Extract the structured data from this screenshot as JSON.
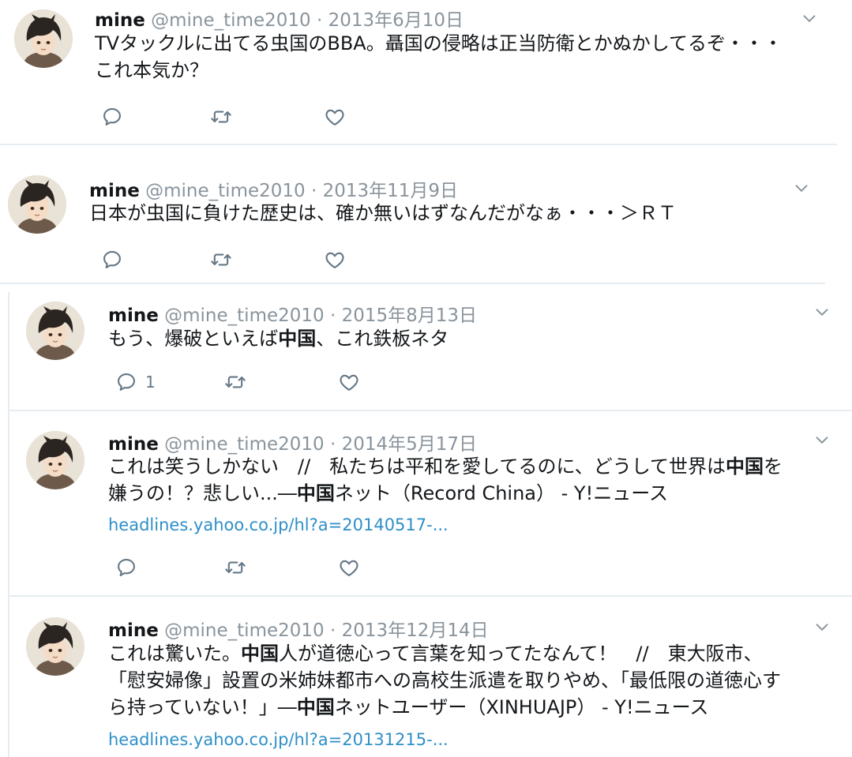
{
  "tweets": [
    {
      "name": "mine",
      "handle": "@mine_time2010",
      "sep": "·",
      "date": "2013年6月10日",
      "lines": [
        [
          {
            "t": "TVタックルに出てる虫国のBBA。聶国の侵略は正当防衛とかぬかしてるぞ・・・"
          }
        ],
        [
          {
            "t": "これ本気か？"
          }
        ]
      ],
      "reply_count": ""
    },
    {
      "name": "mine",
      "handle": "@mine_time2010",
      "sep": "·",
      "date": "2013年11月9日",
      "lines": [
        [
          {
            "t": "日本が虫国に負けた歴史は、確か無いはずなんだがなぁ・・・＞ＲＴ"
          }
        ]
      ],
      "reply_count": ""
    },
    {
      "name": "mine",
      "handle": "@mine_time2010",
      "sep": "·",
      "date": "2015年8月13日",
      "lines": [
        [
          {
            "t": "もう、爆破といえば"
          },
          {
            "t": "中国",
            "b": true
          },
          {
            "t": "、これ鉄板ネタ"
          }
        ]
      ],
      "reply_count": "1"
    },
    {
      "name": "mine",
      "handle": "@mine_time2010",
      "sep": "·",
      "date": "2014年5月17日",
      "lines": [
        [
          {
            "t": "これは笑うしかない　//　私たちは平和を愛してるのに、どうして世界は"
          },
          {
            "t": "中国",
            "b": true
          },
          {
            "t": "を"
          }
        ],
        [
          {
            "t": "嫌うの！？悲しい...―"
          },
          {
            "t": "中国",
            "b": true
          },
          {
            "t": "ネット（Record China） - Y!ニュース"
          }
        ]
      ],
      "link": "headlines.yahoo.co.jp/hl?a=20140517-...",
      "reply_count": ""
    },
    {
      "name": "mine",
      "handle": "@mine_time2010",
      "sep": "·",
      "date": "2013年12月14日",
      "lines": [
        [
          {
            "t": "これは驚いた。"
          },
          {
            "t": "中国",
            "b": true
          },
          {
            "t": "人が道徳心って言葉を知ってたなんて！　//　東大阪市、"
          }
        ],
        [
          {
            "t": "「慰安婦像」設置の米姉妹都市への高校生派遣を取りやめ、「最低限の道徳心す"
          }
        ],
        [
          {
            "t": "ら持っていない！」―"
          },
          {
            "t": "中国",
            "b": true
          },
          {
            "t": "ネットユーザー（XINHUAJP） - Y!ニュース"
          }
        ]
      ],
      "link": "headlines.yahoo.co.jp/hl?a=20131215-...",
      "reply_count": ""
    }
  ],
  "icons": {
    "reply": "reply-icon",
    "retweet": "retweet-icon",
    "like": "like-icon",
    "caret": "chevron-down-icon",
    "avatar": "avatar"
  },
  "colors": {
    "link": "#2f8fc8",
    "muted": "#8a949c",
    "text": "#14171a",
    "divider": "#e6ecf0"
  }
}
